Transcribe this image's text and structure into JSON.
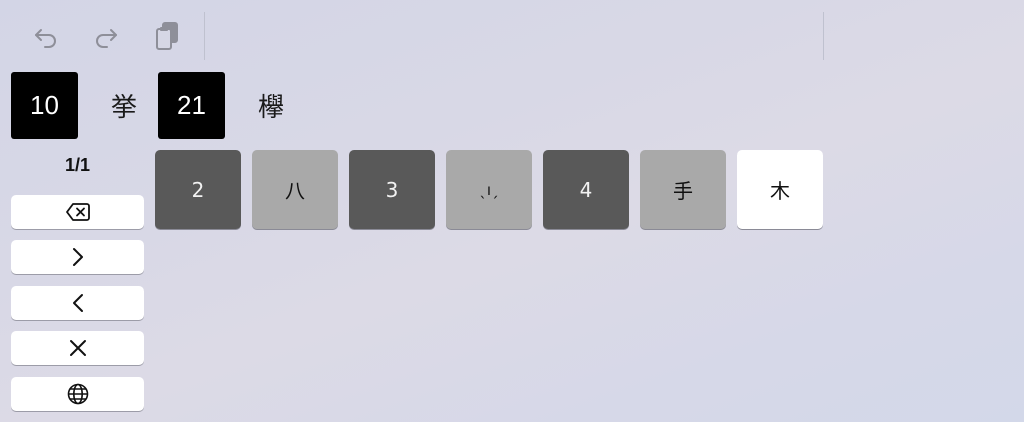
{
  "toolbar": {
    "undo_icon": "undo-arrow-icon",
    "redo_icon": "redo-arrow-icon",
    "paste_icon": "clipboard-paste-icon"
  },
  "candidates": [
    {
      "code": "10",
      "char": "挙"
    },
    {
      "code": "21",
      "char": "欅"
    }
  ],
  "pager": {
    "label": "1/1"
  },
  "side_buttons": [
    {
      "name": "backspace-icon"
    },
    {
      "name": "chevron-right-icon"
    },
    {
      "name": "chevron-left-icon"
    },
    {
      "name": "close-icon"
    },
    {
      "name": "globe-icon"
    }
  ],
  "keys": [
    {
      "label": "2",
      "style": "dark"
    },
    {
      "label": "八",
      "style": "light"
    },
    {
      "label": "3",
      "style": "dark"
    },
    {
      "label": "ˎıˏ",
      "style": "light"
    },
    {
      "label": "4",
      "style": "dark"
    },
    {
      "label": "手",
      "style": "light"
    },
    {
      "label": "木",
      "style": "white"
    }
  ],
  "colors": {
    "dark_key": "#595959",
    "light_key": "#a9a9a9",
    "white_key": "#ffffff",
    "code_box": "#000000"
  }
}
